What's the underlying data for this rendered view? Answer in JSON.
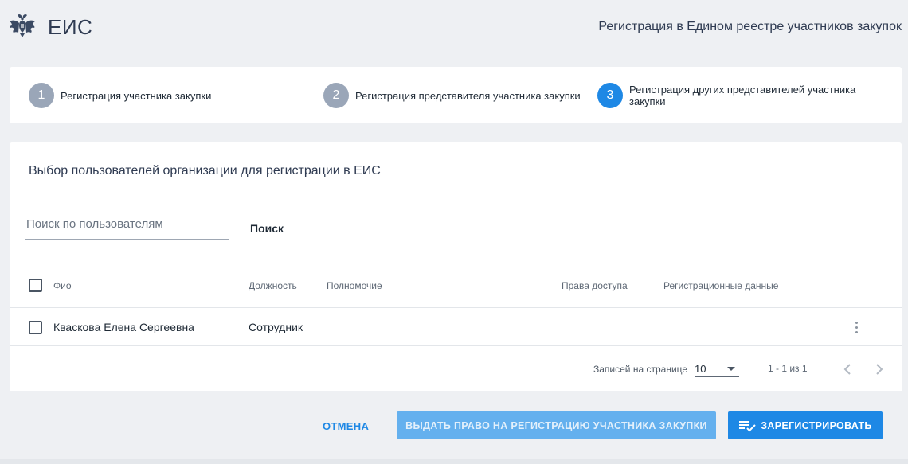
{
  "header": {
    "brand": "ЕИС",
    "page_title": "Регистрация в Едином реестре участников закупок",
    "logo_icon": "coat-of-arms-icon"
  },
  "stepper": {
    "steps": [
      {
        "number": "1",
        "label": "Регистрация участника закупки",
        "active": false
      },
      {
        "number": "2",
        "label": "Регистрация представителя участника закупки",
        "active": false
      },
      {
        "number": "3",
        "label": "Регистрация других представителей участника закупки",
        "active": true
      }
    ]
  },
  "main": {
    "section_title": "Выбор пользователей организации для регистрации в ЕИС",
    "search": {
      "placeholder": "Поиск по пользователям",
      "value": "",
      "button_label": "Поиск"
    },
    "table": {
      "columns": [
        "Фио",
        "Должность",
        "Полномочие",
        "Права доступа",
        "Регистрационные данные"
      ],
      "rows": [
        {
          "fio": "Кваскова Елена Сергеевна",
          "position": "Сотрудник",
          "authority": "",
          "access": "",
          "reg_data": ""
        }
      ]
    },
    "pagination": {
      "per_page_label": "Записей на странице",
      "per_page_value": "10",
      "range": "1 - 1 из 1"
    }
  },
  "footer": {
    "cancel_label": "ОТМЕНА",
    "grant_label": "ВЫДАТЬ ПРАВО НА РЕГИСТРАЦИЮ УЧАСТНИКА ЗАКУПКИ",
    "register_label": "ЗАРЕГИСТРИРОВАТЬ"
  },
  "colors": {
    "accent": "#1e88e5",
    "accent_disabled": "#64b0ee",
    "step_inactive": "#9aa6b8",
    "background": "#eef0f3"
  }
}
